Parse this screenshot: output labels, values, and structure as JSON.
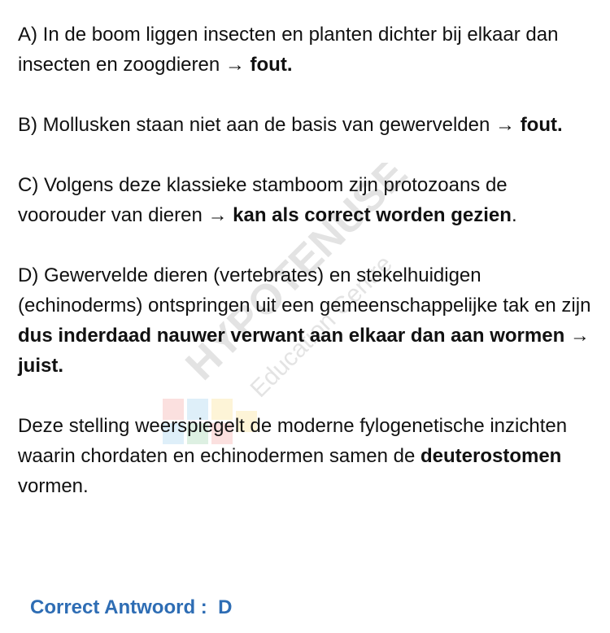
{
  "watermark": {
    "brand": "HYPOTENUSE",
    "sub": "Education Centre"
  },
  "items": {
    "a": {
      "text": "A) In de boom liggen insecten en planten dichter bij elkaar dan insecten en zoogdieren → ",
      "verdict": "fout."
    },
    "b": {
      "text": "B)  Mollusken staan niet aan de basis van gewervelden → ",
      "verdict": "fout."
    },
    "c": {
      "text": "C) Volgens deze klassieke stamboom zijn protozoans de voorouder van dieren → ",
      "verdict": "kan als correct worden gezien",
      "tail": "."
    },
    "d": {
      "text": "D)  Gewervelde dieren (vertebrates) en stekelhuidigen (echinoderms) ontspringen uit een gemeenschappelijke tak en zijn ",
      "verdict": "dus inderdaad nauwer verwant aan elkaar dan aan wormen → juist."
    }
  },
  "explanation": {
    "text": "Deze stelling weerspiegelt de moderne fylogenetische inzichten waarin chordaten en echinodermen samen de ",
    "bold": "deuterostomen",
    "tail": " vormen."
  },
  "answer": {
    "label": "Correct Antwoord :  D",
    "color": "#2e6db4"
  }
}
